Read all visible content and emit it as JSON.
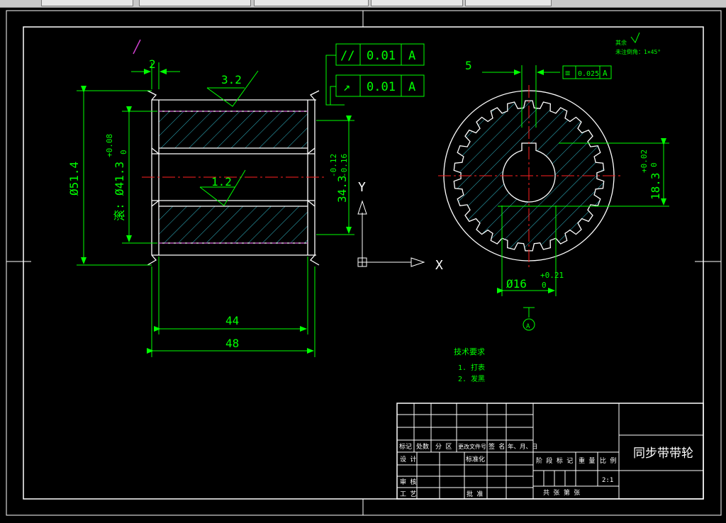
{
  "window": {
    "tabs": [
      "",
      "",
      "",
      "",
      "",
      ""
    ]
  },
  "drawing": {
    "title": "同步带带轮",
    "scale": "2:1",
    "tech_requirements": {
      "heading": "技术要求",
      "items": [
        "1. 打表",
        "2. 发黑"
      ]
    },
    "roughness_note": {
      "line1": "其余",
      "line2": "未注倒角：1×45°"
    },
    "tolerance_frames": [
      {
        "symbol": "//",
        "value": "0.01",
        "datum": "A"
      },
      {
        "symbol": "↗",
        "value": "0.01",
        "datum": "A"
      },
      {
        "symbol": "≡",
        "value": "0.025",
        "datum": "A"
      }
    ],
    "datum_label": "A",
    "axis": {
      "x": "X",
      "y": "Y"
    },
    "dims": {
      "flange_width": "2",
      "roughness_top": "3.2",
      "roughness_bore": "1.2",
      "outer_diameter": "Ø51.4",
      "bore_diameter_prefix": "滚:",
      "bore_diameter": "Ø41.3",
      "bore_tol_upper": "+0.08",
      "bore_tol_lower": "0",
      "tooth_length": "34.3",
      "tooth_tol_upper": "-0.12",
      "tooth_tol_lower": "-0.16",
      "width_inner": "44",
      "width_outer": "48",
      "key_width": "5",
      "hole_diameter": "Ø16",
      "hole_tol_upper": "+0.21",
      "hole_tol_lower": "0",
      "key_depth": "18.3",
      "key_tol_upper": "+0.02",
      "key_tol_lower": "0"
    },
    "title_block": {
      "headers": [
        "标记",
        "处数",
        "分 区",
        "更改文件号",
        "签 名",
        "年、月、日"
      ],
      "rows": [
        "设 计",
        "标准化",
        "审 核",
        "工 艺",
        "批 准"
      ],
      "stage": "阶 段 标 记",
      "weight": "重 量",
      "ratio": "比 例",
      "sheets": "共    张  第    张"
    }
  }
}
